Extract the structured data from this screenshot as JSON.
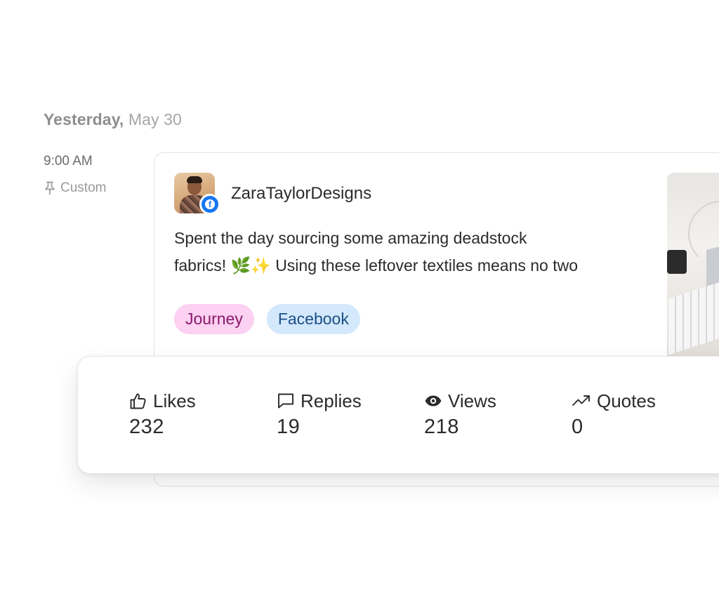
{
  "header": {
    "day_label": "Yesterday,",
    "date_label": "May 30"
  },
  "schedule": {
    "time": "9:00 AM",
    "mode": "Custom",
    "mode_icon": "pin-icon"
  },
  "post": {
    "username": "ZaraTaylorDesigns",
    "platform": "Facebook",
    "platform_icon": "facebook-icon",
    "text_lines": [
      "Spent the day sourcing some amazing deadstock",
      "fabrics! 🌿✨ Using these leftover textiles means no two"
    ],
    "tags": [
      {
        "label": "Journey",
        "bg": "#fcd1f1",
        "fg": "#8a1a6d"
      },
      {
        "label": "Facebook",
        "bg": "#d3e8fb",
        "fg": "#1b4f86"
      }
    ]
  },
  "stats": [
    {
      "label": "Likes",
      "value": "232",
      "icon": "thumbs-up-icon"
    },
    {
      "label": "Replies",
      "value": "19",
      "icon": "speech-bubble-icon"
    },
    {
      "label": "Views",
      "value": "218",
      "icon": "eye-icon"
    },
    {
      "label": "Quotes",
      "value": "0",
      "icon": "trend-arrow-icon"
    }
  ],
  "colors": {
    "facebook_blue": "#1877f2"
  }
}
